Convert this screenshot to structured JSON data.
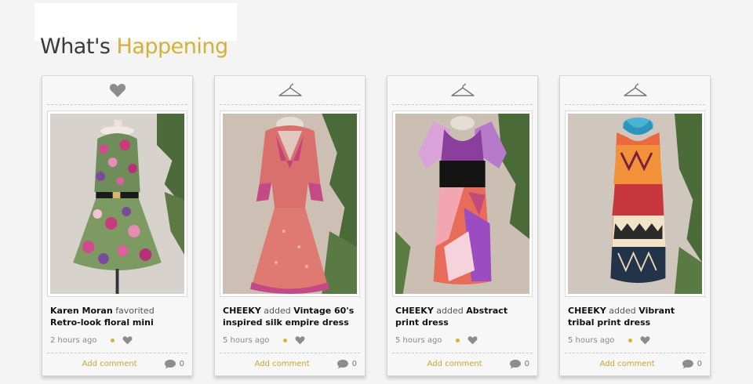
{
  "section": {
    "title_dark": "What's",
    "title_accent": "Happening"
  },
  "colors": {
    "accent": "#d2b23a",
    "text": "#3a3a3a",
    "dot": "#d8b13c"
  },
  "cards": [
    {
      "icon": "heart-icon",
      "user": "Karen Moran",
      "verb": "favorited",
      "item": "Retro-look floral mini",
      "time": "2 hours ago",
      "add_comment": "Add comment",
      "comment_count": "0"
    },
    {
      "icon": "hanger-icon",
      "user": "CHEEKY",
      "verb": "added",
      "item": "Vintage 60's inspired silk empire dress",
      "time": "5 hours ago",
      "add_comment": "Add comment",
      "comment_count": "0"
    },
    {
      "icon": "hanger-icon",
      "user": "CHEEKY",
      "verb": "added",
      "item": "Abstract print dress",
      "time": "5 hours ago",
      "add_comment": "Add comment",
      "comment_count": "0"
    },
    {
      "icon": "hanger-icon",
      "user": "CHEEKY",
      "verb": "added",
      "item": "Vibrant tribal print dress",
      "time": "5 hours ago",
      "add_comment": "Add comment",
      "comment_count": "0"
    }
  ]
}
